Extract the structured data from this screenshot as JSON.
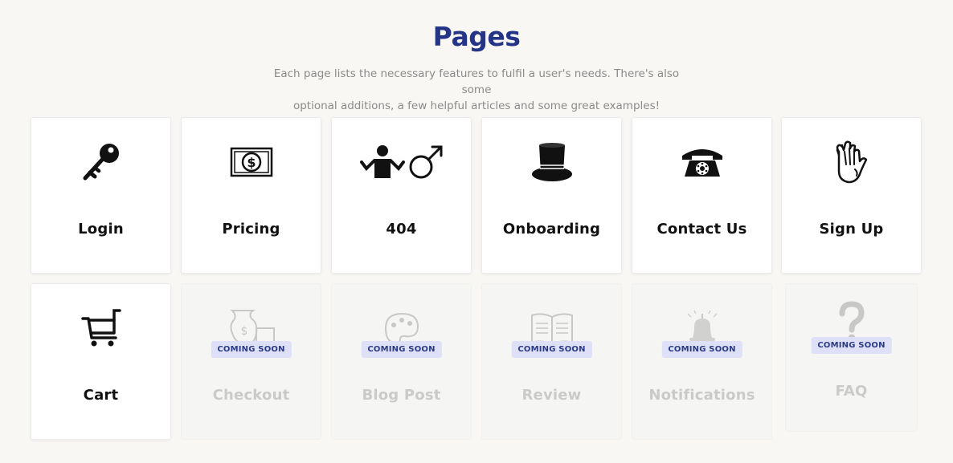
{
  "header": {
    "title": "Pages",
    "subtitle_line1": "Each page lists the necessary features to fulfil a user's needs. There's also some",
    "subtitle_line2": "optional additions, a few helpful articles and some great examples!"
  },
  "colors": {
    "title": "#243487",
    "badge_bg": "#dde0f6",
    "badge_text": "#2c3b86",
    "page_bg": "#f8f7f4"
  },
  "cards": [
    {
      "label": "Login",
      "icon": "key-icon",
      "status": "available"
    },
    {
      "label": "Pricing",
      "icon": "dollar-bill-icon",
      "status": "available"
    },
    {
      "label": "404",
      "icon": "shrug-person-icon",
      "status": "available"
    },
    {
      "label": "Onboarding",
      "icon": "top-hat-icon",
      "status": "available"
    },
    {
      "label": "Contact Us",
      "icon": "telephone-icon",
      "status": "available"
    },
    {
      "label": "Sign Up",
      "icon": "waving-hand-icon",
      "status": "available"
    },
    {
      "label": "Cart",
      "icon": "shopping-cart-icon",
      "status": "available"
    },
    {
      "label": "Checkout",
      "icon": "money-bag-icon",
      "status": "coming-soon",
      "badge": "COMING SOON"
    },
    {
      "label": "Blog Post",
      "icon": "palette-icon",
      "status": "coming-soon",
      "badge": "COMING SOON"
    },
    {
      "label": "Review",
      "icon": "open-book-icon",
      "status": "coming-soon",
      "badge": "COMING SOON"
    },
    {
      "label": "Notifications",
      "icon": "bell-icon",
      "status": "coming-soon",
      "badge": "COMING SOON"
    },
    {
      "label": "FAQ",
      "icon": "question-mark-icon",
      "status": "coming-soon",
      "badge": "COMING SOON"
    }
  ]
}
